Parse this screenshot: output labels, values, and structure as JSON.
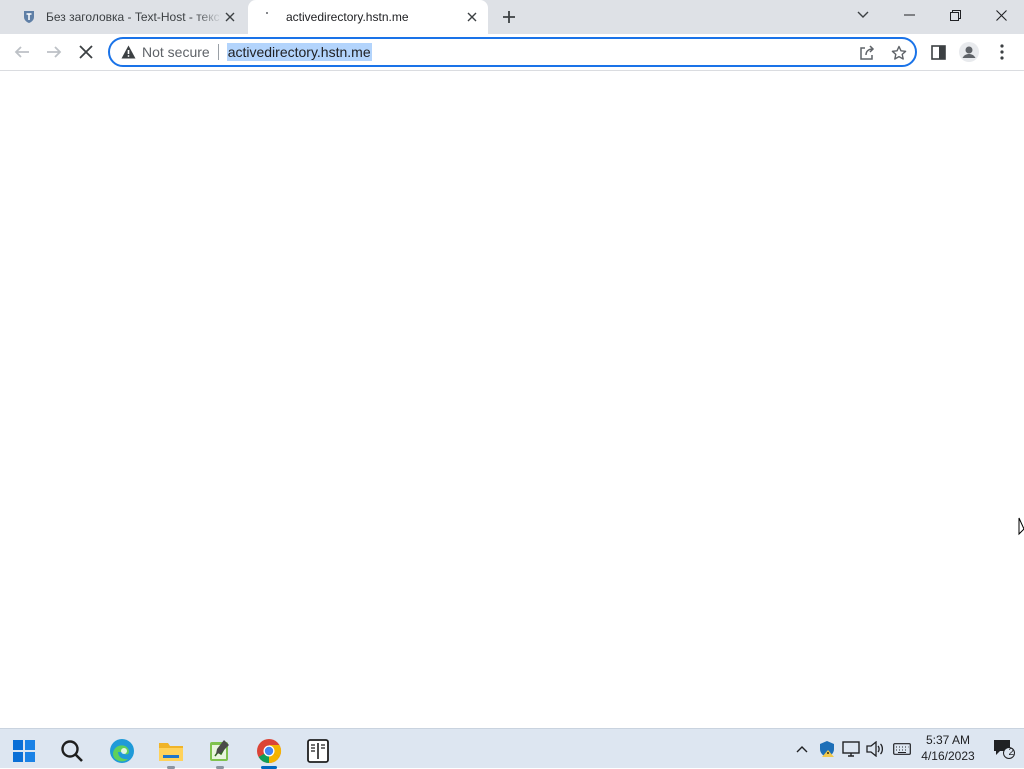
{
  "browser": {
    "tabs": [
      {
        "title": "Без заголовка - Text-Host - текстовый хостинг",
        "active": false
      },
      {
        "title": "activedirectory.hstn.me",
        "active": true
      }
    ],
    "omnibox": {
      "security_label": "Not secure",
      "url": "activedirectory.hstn.me"
    }
  },
  "taskbar": {
    "apps": [
      "start-icon",
      "search-icon",
      "edge-icon",
      "file-explorer-icon",
      "notepad-icon",
      "chrome-icon",
      "reader-icon"
    ],
    "clock": {
      "time": "5:37 AM",
      "date": "4/16/2023"
    },
    "notification_count": "2"
  },
  "colors": {
    "accent": "#1a73e8",
    "tabstrip": "#dee1e6",
    "taskbar": "#dde6f1",
    "selection": "#b3d4fc"
  }
}
